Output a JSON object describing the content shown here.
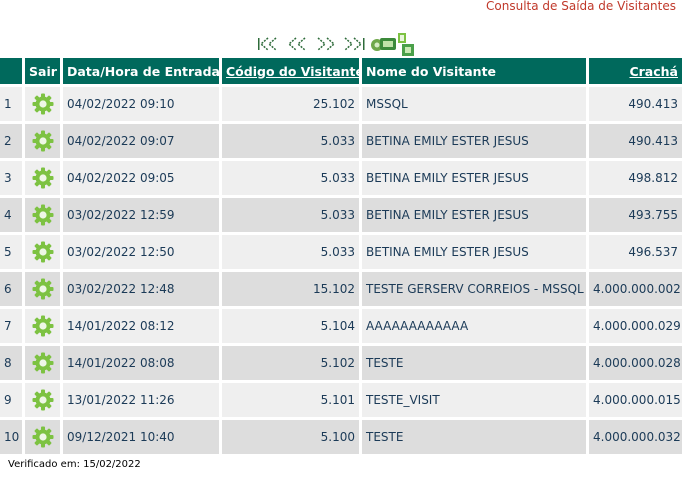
{
  "page": {
    "title": "Consulta de Saída de Visitantes",
    "footer": "Verificado em: 15/02/2022"
  },
  "toolbar": {
    "buttons": [
      "first-page-icon",
      "previous-page-icon",
      "next-page-icon",
      "last-page-icon",
      "export-excel-icon"
    ]
  },
  "columns": {
    "idx": "",
    "sair": "Sair",
    "entrada": "Data/Hora de Entrada",
    "codigo": "Código do Visitante",
    "nome": "Nome do Visitante",
    "cracha": "Crachá"
  },
  "colors": {
    "header_bg": "#00695c",
    "title": "#c0392b",
    "gear": "#7dc242"
  },
  "rows": [
    {
      "idx": "1",
      "entrada": "04/02/2022 09:10",
      "codigo": "25.102",
      "nome": "MSSQL",
      "cracha": "490.413"
    },
    {
      "idx": "2",
      "entrada": "04/02/2022 09:07",
      "codigo": "5.033",
      "nome": "BETINA EMILY ESTER JESUS",
      "cracha": "490.413"
    },
    {
      "idx": "3",
      "entrada": "04/02/2022 09:05",
      "codigo": "5.033",
      "nome": "BETINA EMILY ESTER JESUS",
      "cracha": "498.812"
    },
    {
      "idx": "4",
      "entrada": "03/02/2022 12:59",
      "codigo": "5.033",
      "nome": "BETINA EMILY ESTER JESUS",
      "cracha": "493.755"
    },
    {
      "idx": "5",
      "entrada": "03/02/2022 12:50",
      "codigo": "5.033",
      "nome": "BETINA EMILY ESTER JESUS",
      "cracha": "496.537"
    },
    {
      "idx": "6",
      "entrada": "03/02/2022 12:48",
      "codigo": "15.102",
      "nome": "TESTE GERSERV CORREIOS - MSSQL",
      "cracha": "4.000.000.002"
    },
    {
      "idx": "7",
      "entrada": "14/01/2022 08:12",
      "codigo": "5.104",
      "nome": "AAAAAAAAAAAA",
      "cracha": "4.000.000.029"
    },
    {
      "idx": "8",
      "entrada": "14/01/2022 08:08",
      "codigo": "5.102",
      "nome": "TESTE",
      "cracha": "4.000.000.028"
    },
    {
      "idx": "9",
      "entrada": "13/01/2022 11:26",
      "codigo": "5.101",
      "nome": "TESTE_VISIT",
      "cracha": "4.000.000.015"
    },
    {
      "idx": "10",
      "entrada": "09/12/2021 10:40",
      "codigo": "5.100",
      "nome": "TESTE",
      "cracha": "4.000.000.032"
    }
  ]
}
